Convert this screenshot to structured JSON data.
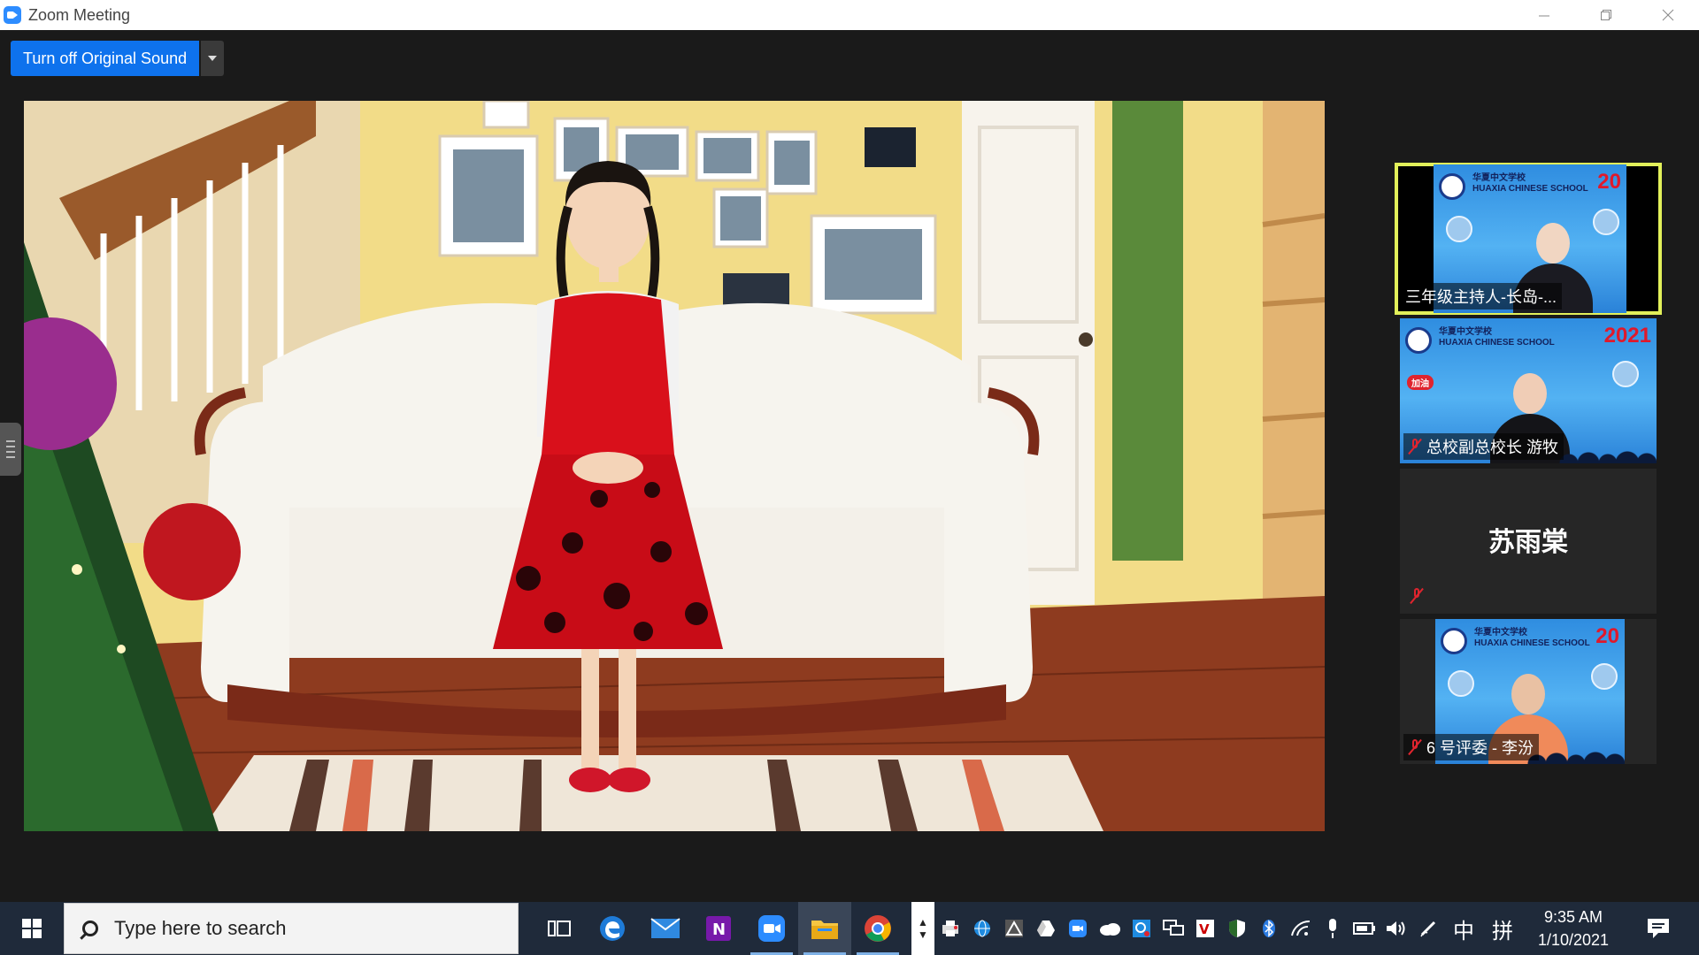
{
  "window": {
    "title": "Zoom Meeting",
    "controls": [
      "minimize",
      "restore",
      "close"
    ]
  },
  "meeting": {
    "original_sound_label": "Turn off Original Sound",
    "participants": [
      {
        "name": "三年级主持人-长岛-...",
        "active_speaker": true,
        "video": true,
        "muted": false,
        "school_text": "华夏中文学校\nHUAXIA CHINESE SCHOOL",
        "year_text": "20"
      },
      {
        "name": "总校副总校长 游牧",
        "active_speaker": false,
        "video": true,
        "muted": true,
        "school_text": "华夏中文学校\nHUAXIA CHINESE SCHOOL",
        "year_text": "2021",
        "badge": "加油"
      },
      {
        "name": "苏雨棠",
        "active_speaker": false,
        "video": false,
        "muted": true
      },
      {
        "name": "6 号评委 - 李汾",
        "active_speaker": false,
        "video": true,
        "muted": true,
        "school_text": "华夏中文学校\nHUAXIA CHINESE SCHOOL",
        "year_text": "20"
      }
    ]
  },
  "taskbar": {
    "search_placeholder": "Type here to search",
    "apps": [
      "task-view",
      "edge",
      "mail",
      "onenote",
      "zoom",
      "file-explorer",
      "chrome"
    ],
    "ime_labels": [
      "中",
      "拼"
    ],
    "time": "9:35 AM",
    "date": "1/10/2021"
  },
  "colors": {
    "zoom_blue": "#0e72ed",
    "active_speaker_border": "#e2f05a",
    "muted_red": "#e0242e",
    "taskbar_bg": "#1f2a3a"
  }
}
